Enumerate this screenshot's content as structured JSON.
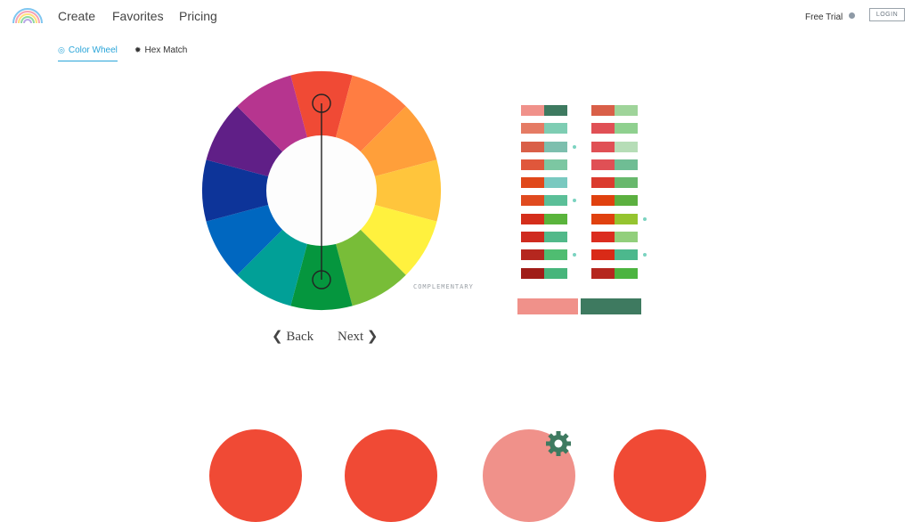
{
  "nav": {
    "items": [
      "Create",
      "Favorites",
      "Pricing"
    ],
    "free_trial": "Free Trial",
    "login": "LOGIN"
  },
  "tabs": [
    {
      "label": "Color Wheel",
      "active": true,
      "icon": "color-wheel-icon"
    },
    {
      "label": "Hex Match",
      "active": false,
      "icon": "hex-icon"
    }
  ],
  "wheel": {
    "segment_colors": [
      "#f04a35",
      "#ff7d42",
      "#ff9f3a",
      "#ffc53c",
      "#fff13e",
      "#78bd38",
      "#05963e",
      "#01a097",
      "#0067c0",
      "#0d3499",
      "#601f87",
      "#b6358f"
    ],
    "harmony_label": "COMPLEMENTARY"
  },
  "pager": {
    "back": "❮ Back",
    "next": "Next ❯"
  },
  "swatches": {
    "left": [
      {
        "a": "#f0918a",
        "b": "#3e7a60",
        "marked": false
      },
      {
        "a": "#e57b64",
        "b": "#7ecdb3",
        "marked": false
      },
      {
        "a": "#d95f48",
        "b": "#7dbfae",
        "marked": true
      },
      {
        "a": "#e0573b",
        "b": "#7cc7a2",
        "marked": false
      },
      {
        "a": "#e0481a",
        "b": "#79c9c0",
        "marked": false
      },
      {
        "a": "#e04a1f",
        "b": "#5bbf98",
        "marked": true
      },
      {
        "a": "#d42e1b",
        "b": "#5ab43c",
        "marked": false
      },
      {
        "a": "#cf2b1f",
        "b": "#52b98a",
        "marked": false
      },
      {
        "a": "#b5271f",
        "b": "#4fbd71",
        "marked": true
      },
      {
        "a": "#a01d18",
        "b": "#47b57b",
        "marked": false
      }
    ],
    "right": [
      {
        "a": "#d95f48",
        "b": "#9fd49a",
        "marked": false
      },
      {
        "a": "#e05055",
        "b": "#8fd08f",
        "marked": false
      },
      {
        "a": "#e05055",
        "b": "#b6ddb7",
        "marked": false
      },
      {
        "a": "#e05055",
        "b": "#6fbd94",
        "marked": false
      },
      {
        "a": "#db3b2e",
        "b": "#68b86d",
        "marked": false
      },
      {
        "a": "#e0410f",
        "b": "#5cb040",
        "marked": false
      },
      {
        "a": "#e0410f",
        "b": "#95c42f",
        "marked": true
      },
      {
        "a": "#db2d1f",
        "b": "#92cf7c",
        "marked": false
      },
      {
        "a": "#d92a17",
        "b": "#4cb88d",
        "marked": true
      },
      {
        "a": "#b5271f",
        "b": "#4cb440",
        "marked": false
      }
    ],
    "selected": {
      "a": "#f0918a",
      "b": "#3e7a60"
    }
  },
  "bottom": {
    "circles": [
      "#f04a35",
      "#f04a35",
      "#f0918a",
      "#f04a35"
    ],
    "gear_color": "#3e7a60"
  }
}
